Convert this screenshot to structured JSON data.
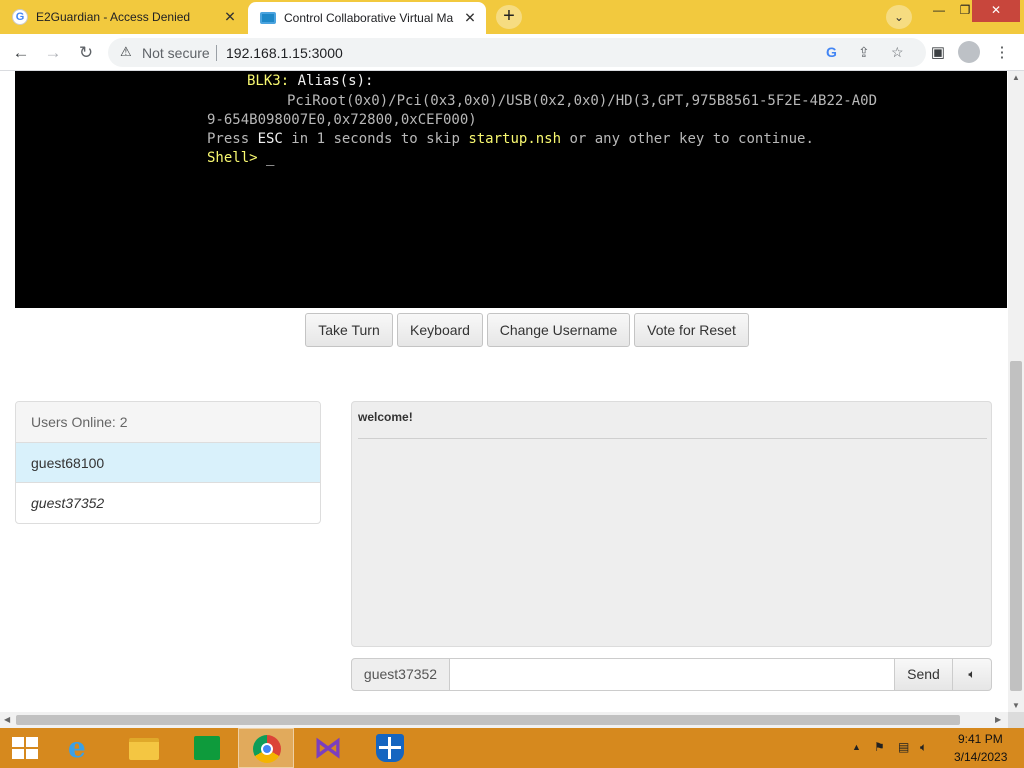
{
  "browser": {
    "tabs": [
      {
        "title": "E2Guardian - Access Denied",
        "favicon": "google-g-icon",
        "active": false
      },
      {
        "title": "Control Collaborative Virtual Ma",
        "favicon": "monitor-icon",
        "active": true
      }
    ],
    "new_tab_symbol": "+",
    "address": {
      "security_label": "Not secure",
      "url": "192.168.1.15:3000"
    }
  },
  "vm": {
    "lines": {
      "l1_label": "BLK3:",
      "l1_text": " Alias(s):",
      "l2": "PciRoot(0x0)/Pci(0x3,0x0)/USB(0x2,0x0)/HD(3,GPT,975B8561-5F2E-4B22-A0D",
      "l3": "9-654B098007E0,0x72800,0xCEF000)",
      "l4_a": "Press ",
      "l4_esc": "ESC",
      "l4_b": " in 1 seconds to skip ",
      "l4_nsh": "startup.nsh",
      "l4_c": " or any other key to continue.",
      "l5_prompt": "Shell> ",
      "l5_cursor": "_"
    },
    "colors": {
      "background": "#000000",
      "text": "#b8b8b8",
      "highlight": "#f8f870"
    }
  },
  "controls": {
    "take_turn": "Take Turn",
    "keyboard": "Keyboard",
    "change_username": "Change Username",
    "vote_reset": "Vote for Reset"
  },
  "users": {
    "heading": "Users Online: 2",
    "list": [
      "guest68100",
      "guest37352"
    ]
  },
  "chat": {
    "messages": [
      "welcome!"
    ],
    "username": "guest37352",
    "input_value": "",
    "send_label": "Send",
    "sound_icon": "speaker-icon"
  },
  "taskbar": {
    "apps": [
      "start-icon",
      "internet-explorer-icon",
      "file-explorer-icon",
      "store-icon",
      "chrome-icon",
      "visual-studio-icon",
      "defender-icon"
    ],
    "active_app": "chrome-icon",
    "clock_time": "9:41 PM",
    "clock_date": "3/14/2023"
  }
}
